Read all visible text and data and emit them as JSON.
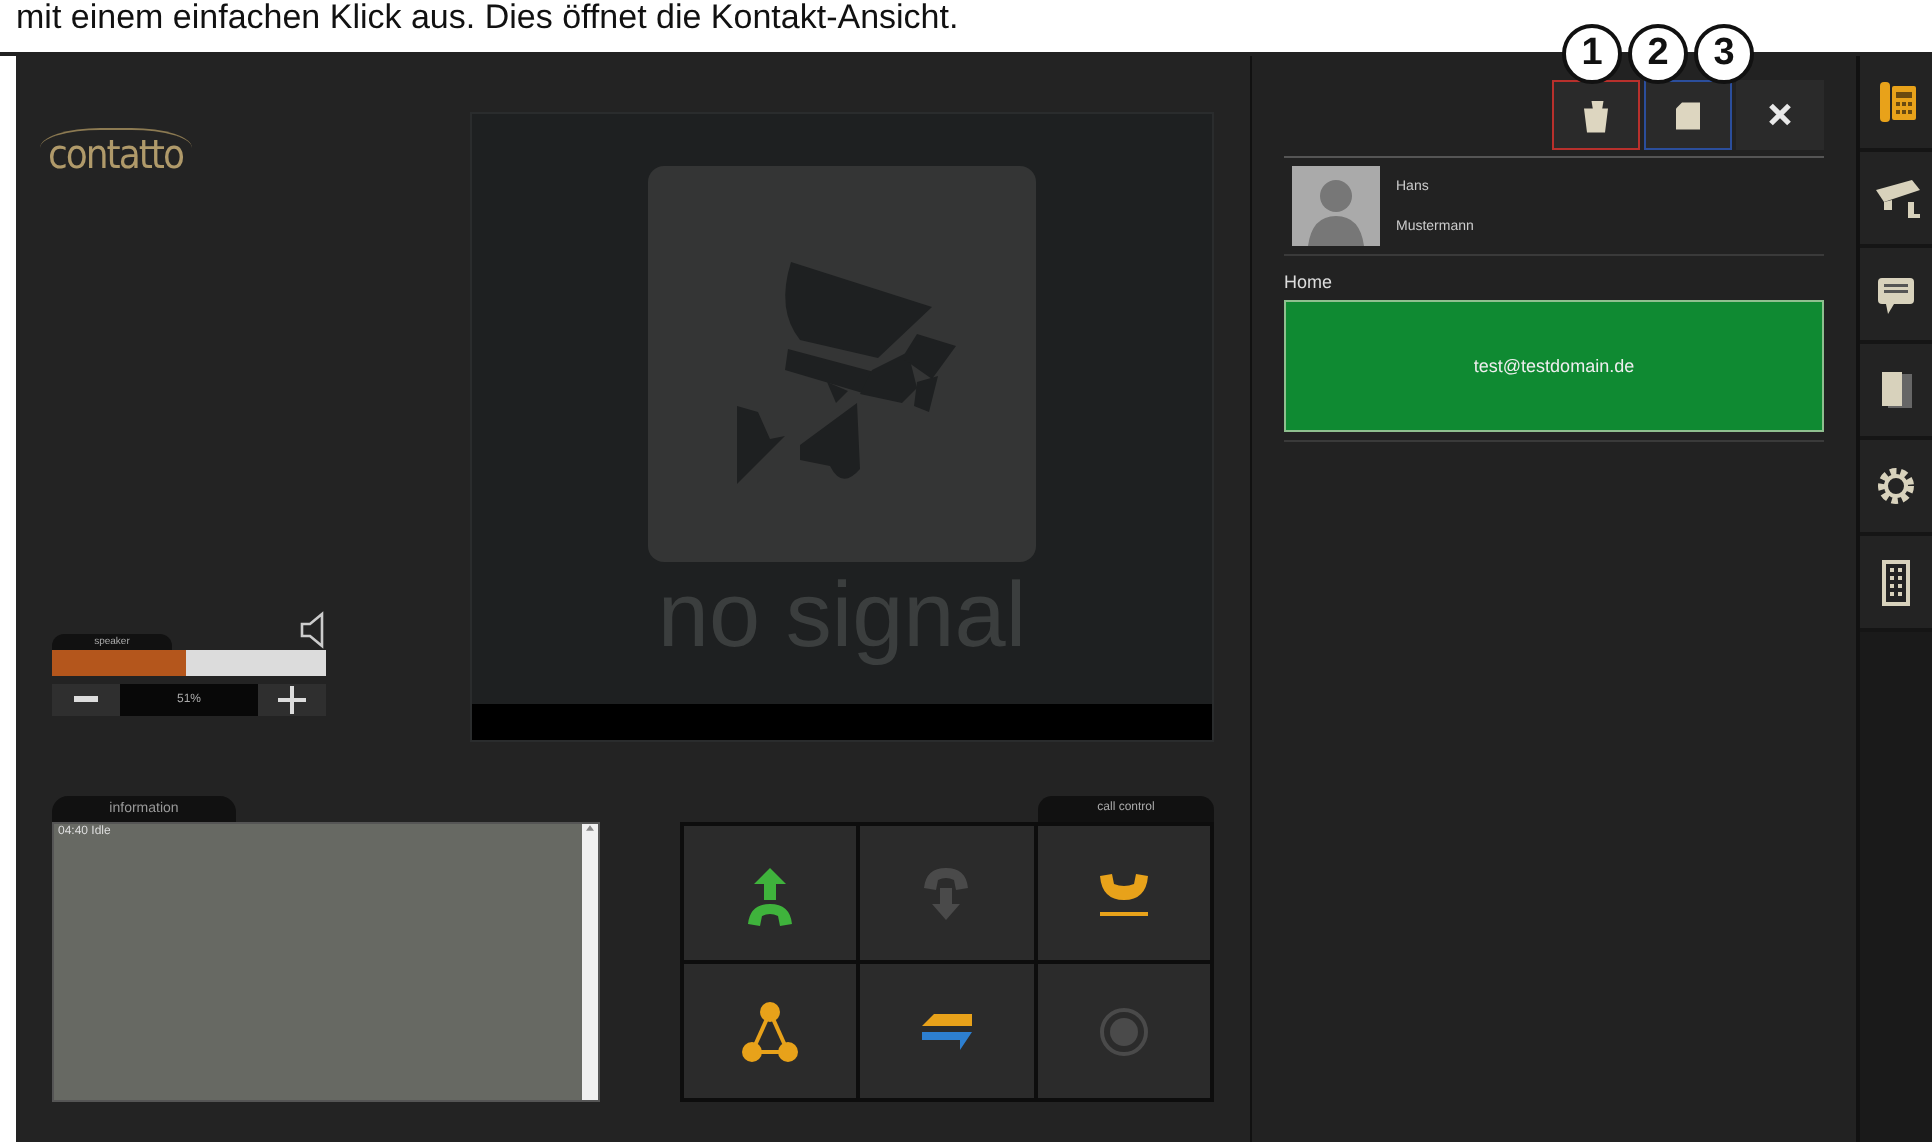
{
  "caption": "mit einem einfachen Klick aus. Dies öffnet die Kontakt-Ansicht.",
  "callouts": [
    "1",
    "2",
    "3"
  ],
  "logo": "contatto",
  "video": {
    "status": "no signal"
  },
  "speaker": {
    "label": "speaker",
    "level": 0.49,
    "reading": "51%"
  },
  "information": {
    "title": "information",
    "lines": [
      "04:40 Idle"
    ]
  },
  "call_control": {
    "title": "call control",
    "buttons": [
      {
        "kind": "pickup",
        "disabled": false
      },
      {
        "kind": "hangup",
        "disabled": true
      },
      {
        "kind": "hold",
        "disabled": false
      },
      {
        "kind": "conference",
        "disabled": false
      },
      {
        "kind": "transfer",
        "disabled": false
      },
      {
        "kind": "record",
        "disabled": true
      }
    ]
  },
  "contact": {
    "actions": [
      {
        "kind": "delete",
        "color": "#b8302c"
      },
      {
        "kind": "edit",
        "color": "#2b4e9c"
      },
      {
        "kind": "close",
        "color": "#2a2a2a"
      }
    ],
    "first_name": "Hans",
    "last_name": "Mustermann",
    "section": "Home",
    "email": "test@testdomain.de"
  },
  "sidebar": [
    {
      "kind": "phone",
      "selected": true
    },
    {
      "kind": "camera",
      "selected": false
    },
    {
      "kind": "message",
      "selected": false
    },
    {
      "kind": "documents",
      "selected": false
    },
    {
      "kind": "settings",
      "selected": false
    },
    {
      "kind": "keypad",
      "selected": false
    }
  ]
}
